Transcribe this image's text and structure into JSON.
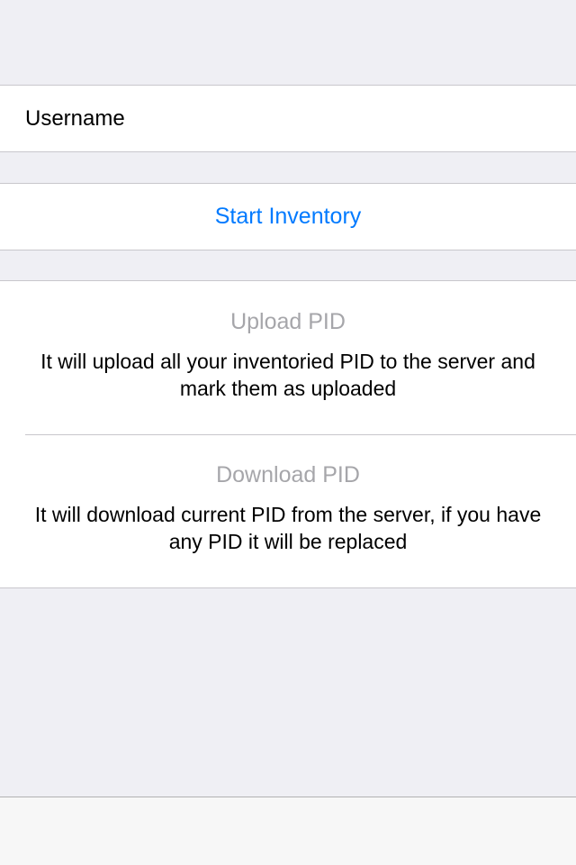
{
  "form": {
    "username_label": "Username",
    "username_value": "",
    "username_placeholder": ""
  },
  "start_inventory": {
    "label": "Start Inventory"
  },
  "actions": {
    "upload": {
      "title": "Upload PID",
      "description": "It will upload all your inventoried PID to the server and mark them as uploaded"
    },
    "download": {
      "title": "Download PID",
      "description": "It will download current PID from the server, if you have any PID it will be replaced"
    }
  },
  "colors": {
    "background": "#efeff4",
    "accent": "#007aff",
    "disabled_title": "#a6a6aa",
    "separator": "#c8c7cc"
  }
}
